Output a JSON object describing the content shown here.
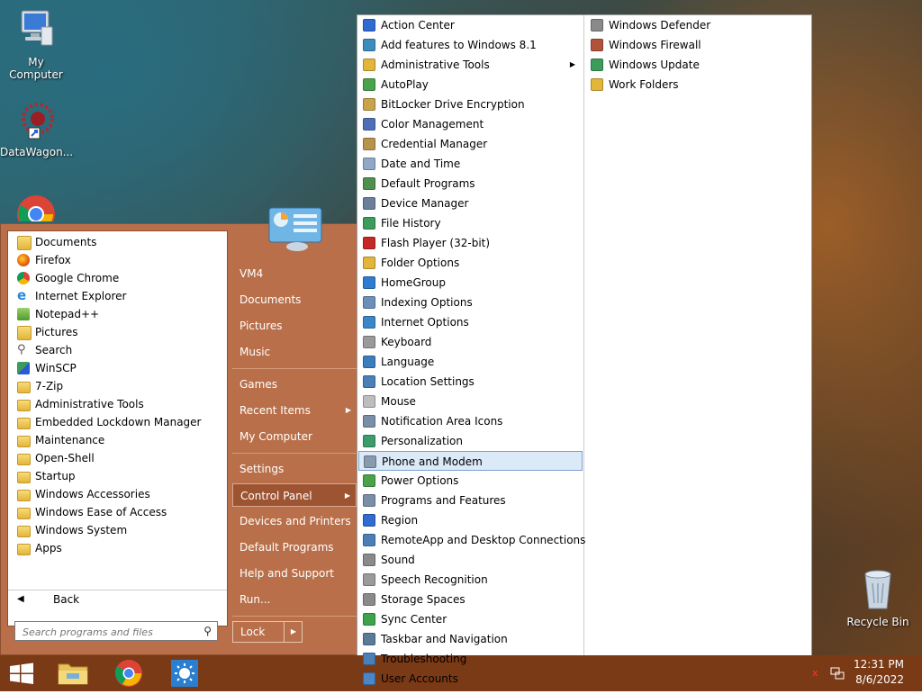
{
  "desktop": {
    "icons": [
      {
        "label": "My Computer"
      },
      {
        "label": "DataWagon..."
      },
      {
        "label": "Recycle Bin"
      }
    ]
  },
  "start_menu": {
    "programs": [
      {
        "label": "Documents",
        "icon": "documents-icon"
      },
      {
        "label": "Firefox",
        "icon": "firefox-icon"
      },
      {
        "label": "Google Chrome",
        "icon": "chrome-icon"
      },
      {
        "label": "Internet Explorer",
        "icon": "ie-icon"
      },
      {
        "label": "Notepad++",
        "icon": "notepadpp-icon"
      },
      {
        "label": "Pictures",
        "icon": "pictures-icon"
      },
      {
        "label": "Search",
        "icon": "search-icon"
      },
      {
        "label": "WinSCP",
        "icon": "winscp-icon"
      },
      {
        "label": "7-Zip",
        "icon": "folder-icon"
      },
      {
        "label": "Administrative Tools",
        "icon": "folder-icon"
      },
      {
        "label": "Embedded Lockdown Manager",
        "icon": "folder-icon"
      },
      {
        "label": "Maintenance",
        "icon": "folder-icon"
      },
      {
        "label": "Open-Shell",
        "icon": "folder-icon"
      },
      {
        "label": "Startup",
        "icon": "folder-icon"
      },
      {
        "label": "Windows Accessories",
        "icon": "folder-icon"
      },
      {
        "label": "Windows Ease of Access",
        "icon": "folder-icon"
      },
      {
        "label": "Windows System",
        "icon": "folder-icon"
      },
      {
        "label": "Apps",
        "icon": "apps-icon"
      }
    ],
    "back_label": "Back",
    "search_placeholder": "Search programs and files",
    "right_items": [
      {
        "label": "VM4"
      },
      {
        "label": "Documents"
      },
      {
        "label": "Pictures"
      },
      {
        "label": "Music"
      },
      {
        "label": "Games"
      },
      {
        "label": "Recent Items"
      },
      {
        "label": "My Computer"
      },
      {
        "label": "Settings"
      },
      {
        "label": "Control Panel"
      },
      {
        "label": "Devices and Printers"
      },
      {
        "label": "Default Programs"
      },
      {
        "label": "Help and Support"
      },
      {
        "label": "Run..."
      }
    ],
    "lock_label": "Lock"
  },
  "control_panel": {
    "column1": [
      {
        "label": "Action Center",
        "color": "#2f6bd1"
      },
      {
        "label": "Add features to Windows 8.1",
        "color": "#3c8dbc"
      },
      {
        "label": "Administrative Tools",
        "color": "#e2b53b"
      },
      {
        "label": "AutoPlay",
        "color": "#4aa34a"
      },
      {
        "label": "BitLocker Drive Encryption",
        "color": "#c9a34b"
      },
      {
        "label": "Color Management",
        "color": "#4e6fb8"
      },
      {
        "label": "Credential Manager",
        "color": "#b8934b"
      },
      {
        "label": "Date and Time",
        "color": "#8fa8c8"
      },
      {
        "label": "Default Programs",
        "color": "#4f8f4f"
      },
      {
        "label": "Device Manager",
        "color": "#6b7f9a"
      },
      {
        "label": "File History",
        "color": "#3d9b5b"
      },
      {
        "label": "Flash Player (32-bit)",
        "color": "#c62828"
      },
      {
        "label": "Folder Options",
        "color": "#e2b53b"
      },
      {
        "label": "HomeGroup",
        "color": "#2f7bd1"
      },
      {
        "label": "Indexing Options",
        "color": "#6b8fb8"
      },
      {
        "label": "Internet Options",
        "color": "#3a86c8"
      },
      {
        "label": "Keyboard",
        "color": "#9a9a9a"
      },
      {
        "label": "Language",
        "color": "#3c7dbd"
      },
      {
        "label": "Location Settings",
        "color": "#4a7fb8"
      },
      {
        "label": "Mouse",
        "color": "#bdbdbd"
      },
      {
        "label": "Notification Area Icons",
        "color": "#7a8ea8"
      },
      {
        "label": "Personalization",
        "color": "#3e9b6b"
      },
      {
        "label": "Phone and Modem",
        "color": "#8a9aae"
      },
      {
        "label": "Power Options",
        "color": "#4aa34a"
      },
      {
        "label": "Programs and Features",
        "color": "#7a8ea8"
      },
      {
        "label": "Region",
        "color": "#2f6bd1"
      },
      {
        "label": "RemoteApp and Desktop Connections",
        "color": "#4a7fb8"
      },
      {
        "label": "Sound",
        "color": "#8a8a8a"
      },
      {
        "label": "Speech Recognition",
        "color": "#9a9a9a"
      },
      {
        "label": "Storage Spaces",
        "color": "#8a8a8a"
      },
      {
        "label": "Sync Center",
        "color": "#3da34a"
      },
      {
        "label": "Taskbar and Navigation",
        "color": "#5a7a9a"
      },
      {
        "label": "Troubleshooting",
        "color": "#4a7fb8"
      },
      {
        "label": "User Accounts",
        "color": "#4a86c8"
      }
    ],
    "column2": [
      {
        "label": "Windows Defender",
        "color": "#8a8a8a"
      },
      {
        "label": "Windows Firewall",
        "color": "#b0533a"
      },
      {
        "label": "Windows Update",
        "color": "#3d9b5b"
      },
      {
        "label": "Work Folders",
        "color": "#e2b53b"
      }
    ],
    "highlighted": "Phone and Modem"
  },
  "taskbar": {
    "time": "12:31 PM",
    "date": "8/6/2022"
  }
}
